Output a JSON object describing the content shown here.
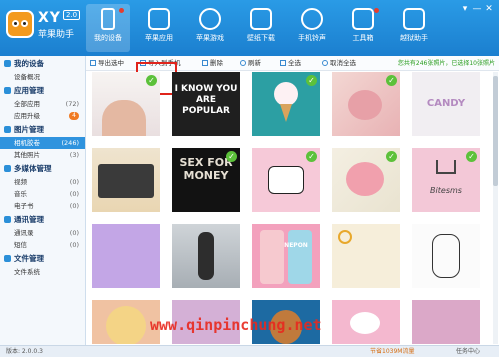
{
  "app": {
    "name": "XY",
    "version_badge": "2.0",
    "subtitle": "苹果助手"
  },
  "nav": [
    {
      "label": "我的设备",
      "icon": "phone-icon"
    },
    {
      "label": "苹果应用",
      "icon": "apps-icon"
    },
    {
      "label": "苹果游戏",
      "icon": "plus-icon"
    },
    {
      "label": "壁纸下载",
      "icon": "picture-icon"
    },
    {
      "label": "手机铃声",
      "icon": "music-icon"
    },
    {
      "label": "工具箱",
      "icon": "toolbox-icon"
    },
    {
      "label": "越狱助手",
      "icon": "jailbreak-icon"
    }
  ],
  "window_controls": [
    "▾",
    "—",
    "✕"
  ],
  "sidebar": {
    "groups": [
      {
        "title": "我的设备",
        "items": [
          {
            "label": "设备概况",
            "count": ""
          }
        ]
      },
      {
        "title": "应用管理",
        "items": [
          {
            "label": "全部应用",
            "count": "(72)"
          },
          {
            "label": "应用升级",
            "count": "",
            "badge": "4"
          }
        ]
      },
      {
        "title": "图片管理",
        "items": [
          {
            "label": "相机胶卷",
            "count": "(246)"
          },
          {
            "label": "其他照片",
            "count": "(3)"
          }
        ]
      },
      {
        "title": "多媒体管理",
        "items": [
          {
            "label": "视频",
            "count": "(0)"
          },
          {
            "label": "音乐",
            "count": "(0)"
          },
          {
            "label": "电子书",
            "count": "(0)"
          }
        ]
      },
      {
        "title": "通讯管理",
        "items": [
          {
            "label": "通讯录",
            "count": "(0)"
          },
          {
            "label": "短信",
            "count": "(0)"
          }
        ]
      },
      {
        "title": "文件管理",
        "items": [
          {
            "label": "文件系统",
            "count": ""
          }
        ]
      }
    ]
  },
  "toolbar": {
    "export": "导出选中",
    "import": "导入到手机",
    "delete": "删除",
    "refresh": "刷新",
    "select_all": "全选",
    "deselect_all": "取消全选",
    "status": "您共有246张照片，已选择10张照片"
  },
  "tiles": [
    {
      "text": "",
      "checked": true
    },
    {
      "text": "I KNOW YOU ARE POPULAR",
      "checked": false
    },
    {
      "text": "",
      "checked": true
    },
    {
      "text": "",
      "checked": true
    },
    {
      "text": "CANDY",
      "checked": false
    },
    {
      "text": "",
      "checked": false
    },
    {
      "text": "SEX FOR MONEY",
      "checked": true
    },
    {
      "text": "",
      "checked": true
    },
    {
      "text": "",
      "checked": true
    },
    {
      "text": "Bitesms",
      "checked": true
    },
    {
      "text": "",
      "checked": false
    },
    {
      "text": "",
      "checked": false
    },
    {
      "text": "NEPON",
      "checked": false
    },
    {
      "text": "",
      "checked": false
    },
    {
      "text": "",
      "checked": false
    },
    {
      "text": "",
      "checked": false
    },
    {
      "text": "",
      "checked": false
    },
    {
      "text": "",
      "checked": false
    },
    {
      "text": "",
      "checked": false
    },
    {
      "text": "",
      "checked": false
    }
  ],
  "watermark": "www.qinpinchung.net",
  "statusbar": {
    "version": "版本: 2.0.0.3",
    "saving": "节省1039M流量",
    "downloads": "任务中心"
  }
}
